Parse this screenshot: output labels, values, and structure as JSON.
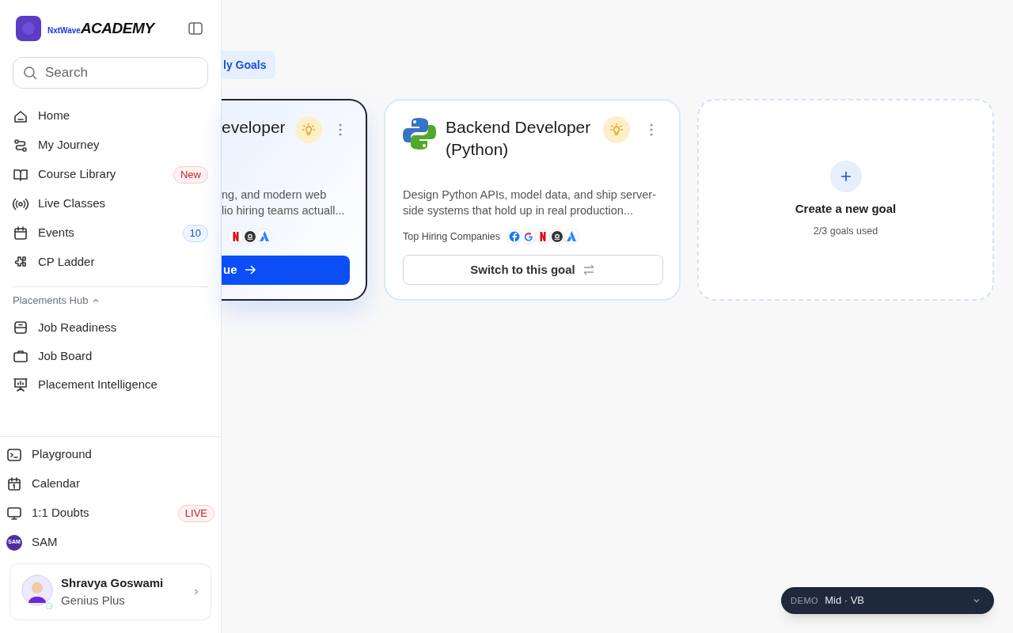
{
  "sidebar": {
    "logo": {
      "small": "NxtWave",
      "large": "ACADEMY"
    },
    "search": {
      "placeholder": "Search"
    },
    "items": [
      {
        "label": "Home",
        "kind": "home"
      },
      {
        "label": "My Journey",
        "kind": "route"
      },
      {
        "label": "Course Library",
        "kind": "book",
        "badge": {
          "text": "New",
          "kind": "alert"
        }
      },
      {
        "label": "Live Classes",
        "kind": "broadcast"
      },
      {
        "label": "Events",
        "kind": "calendar",
        "badge": {
          "text": "10",
          "kind": "count"
        }
      },
      {
        "label": "CP Ladder",
        "kind": "puzzle"
      }
    ],
    "section": {
      "title": "Placements Hub",
      "expanded": true,
      "items": [
        {
          "label": "Job Readiness",
          "kind": "drawer"
        },
        {
          "label": "Job Board",
          "kind": "briefcase"
        },
        {
          "label": "Placement Intelligence",
          "kind": "presentation"
        }
      ]
    },
    "footer_items": [
      {
        "label": "Playground",
        "kind": "terminal"
      },
      {
        "label": "Calendar",
        "kind": "calendar1"
      },
      {
        "label": "1:1 Doubts",
        "kind": "monitor",
        "badge": {
          "text": "LIVE",
          "kind": "alert"
        }
      },
      {
        "label": "SAM",
        "kind": "sam",
        "avatar_text": "SAM"
      }
    ],
    "user": {
      "name": "Shravya Goswami",
      "plan": "Genius Plus"
    }
  },
  "main": {
    "tab": {
      "label": "ly Goals",
      "selected": true
    },
    "goals": [
      {
        "selected": true,
        "title": [
          "eveloper"
        ],
        "description": [
          "ng, and modern web",
          "lio hiring teams actuall..."
        ],
        "button": "ue"
      },
      {
        "selected": false,
        "title": [
          "Backend Developer",
          "(Python)"
        ],
        "description": [
          "Design Python APIs, model data, and ship server-",
          "side systems that hold up in real production..."
        ],
        "hiring_label": "Top Hiring Companies",
        "button": "Switch to this goal"
      }
    ],
    "create": {
      "title": "Create a new goal",
      "usage": "2/3 goals used"
    }
  },
  "demo": {
    "label": "DEMO",
    "value": "Mid · VB"
  }
}
